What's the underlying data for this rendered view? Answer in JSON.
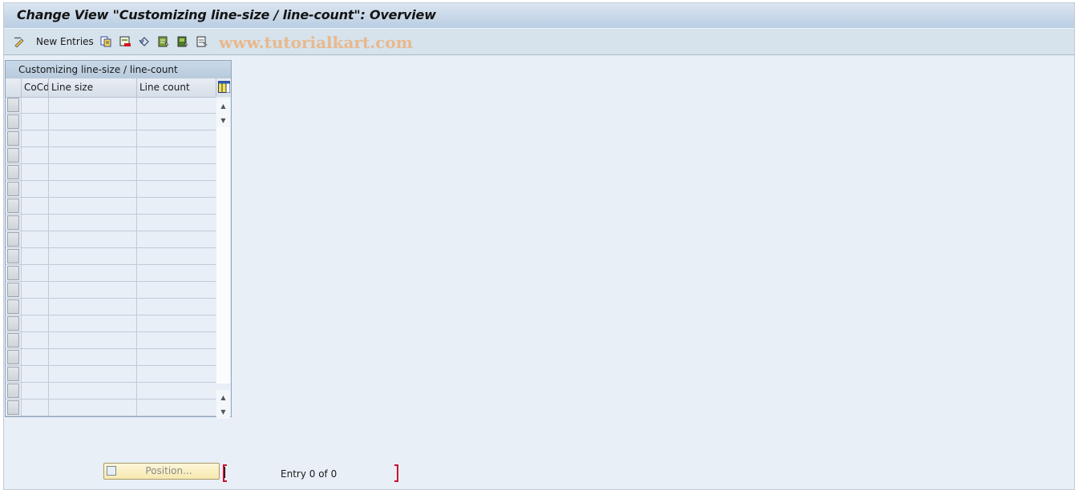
{
  "window": {
    "title": "Change View \"Customizing line-size / line-count\": Overview"
  },
  "toolbar": {
    "new_entries_label": "New Entries",
    "icons": [
      "change-display-icon",
      "copy-icon",
      "delete-icon",
      "undo-change-icon",
      "select-all-icon",
      "select-block-icon",
      "deselect-all-icon"
    ],
    "watermark": "www.tutorialkart.com"
  },
  "table": {
    "title": "Customizing line-size / line-count",
    "columns": [
      "CoCd",
      "Line size",
      "Line count"
    ],
    "row_count_visible": 19,
    "rows": []
  },
  "footer": {
    "position_button_label": "Position...",
    "entry_status": "Entry 0 of 0"
  }
}
